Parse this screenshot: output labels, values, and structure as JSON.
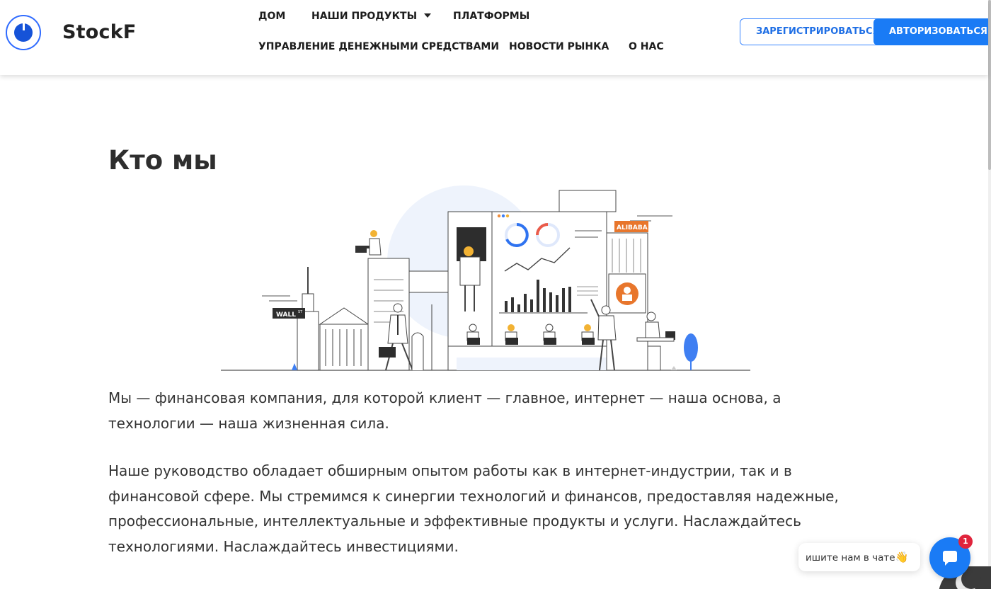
{
  "header": {
    "brand": "StockF",
    "nav": {
      "home": "ДОМ",
      "products": "НАШИ ПРОДУКТЫ",
      "platforms": "ПЛАТФОРМЫ",
      "money_management": "УПРАВЛЕНИЕ ДЕНЕЖНЫМИ СРЕДСТВАМИ",
      "market_news": "НОВОСТИ РЫНКА",
      "about": "О НАС"
    },
    "register_label": "ЗАРЕГИСТРИРОВАТЬСЯ",
    "login_label": "АВТОРИЗОВАТЬСЯ"
  },
  "main": {
    "title": "Кто мы",
    "illustration": {
      "street_sign": "WALL",
      "street_sign_suffix": "ST",
      "billboard": "ALIBABA"
    },
    "paragraph1": "Мы — финансовая компания, для которой клиент — главное, интернет — наша основа, а технологии — наша жизненная сила.",
    "paragraph2": "Наше руководство обладает обширным опытом работы как в интернет-индустрии, так и в финансовой сфере. Мы стремимся к синергии технологий и финансов, предоставляя надежные, профессиональные, интеллектуальные и эффективные продукты и услуги. Наслаждайтесь технологиями. Наслаждайтесь инвестициями."
  },
  "chat": {
    "prompt": "ишите нам в чате",
    "wave_emoji": "👋",
    "unread_count": "1"
  },
  "colors": {
    "accent": "#1a7bf5",
    "badge": "#e0243c",
    "billboard": "#e8762c"
  }
}
